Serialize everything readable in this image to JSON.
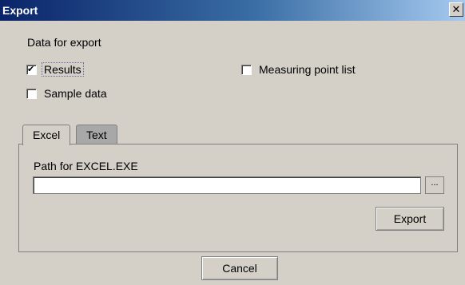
{
  "window": {
    "title": "Export",
    "close_glyph": "✕"
  },
  "data_section": {
    "label": "Data for export",
    "results": {
      "label": "Results",
      "checked": true
    },
    "sample_data": {
      "label": "Sample data",
      "checked": false
    },
    "measuring_point_list": {
      "label": "Measuring point list",
      "checked": false
    }
  },
  "tabs": [
    {
      "label": "Excel",
      "selected": true
    },
    {
      "label": "Text",
      "selected": false
    }
  ],
  "excel_panel": {
    "path_label": "Path for EXCEL.EXE",
    "path_value": "",
    "browse_label": "...",
    "export_label": "Export"
  },
  "footer": {
    "cancel_label": "Cancel"
  }
}
